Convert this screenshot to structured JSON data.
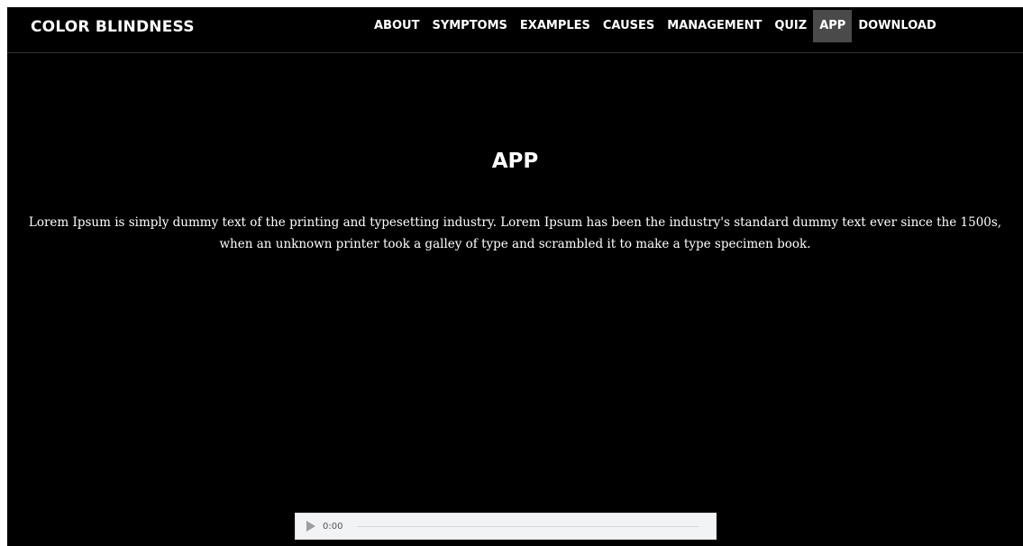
{
  "brand": "COLOR BLINDNESS",
  "nav": {
    "items": [
      {
        "label": "ABOUT",
        "active": false
      },
      {
        "label": "SYMPTOMS",
        "active": false
      },
      {
        "label": "EXAMPLES",
        "active": false
      },
      {
        "label": "CAUSES",
        "active": false
      },
      {
        "label": "MANAGEMENT",
        "active": false
      },
      {
        "label": "QUIZ",
        "active": false
      },
      {
        "label": "APP",
        "active": true
      },
      {
        "label": "DOWNLOAD",
        "active": false
      }
    ]
  },
  "section": {
    "title": "APP",
    "text": "Lorem Ipsum is simply dummy text of the printing and typesetting industry. Lorem Ipsum has been the industry's standard dummy text ever since the 1500s, when an unknown printer took a galley of type and scrambled it to make a type specimen book."
  },
  "audio": {
    "time": "0:00",
    "icon": "play-icon"
  },
  "colors": {
    "background": "#000000",
    "text": "#ffffff",
    "active_nav_bg": "#4a4a4a",
    "player_bg": "#f1f3f4"
  }
}
